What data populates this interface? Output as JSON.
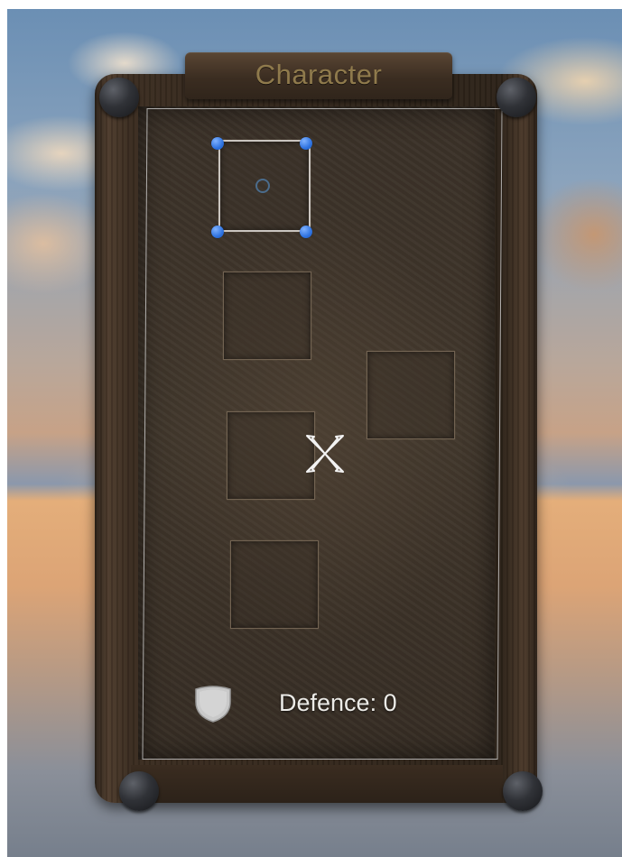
{
  "panel": {
    "title": "Character"
  },
  "equipment_slots": [
    {
      "id": "slot-1",
      "selected": true
    },
    {
      "id": "slot-2",
      "selected": false
    },
    {
      "id": "slot-3",
      "selected": false
    },
    {
      "id": "slot-4",
      "selected": false
    },
    {
      "id": "slot-5",
      "selected": false
    }
  ],
  "stats": {
    "defence_label": "Defence: 0",
    "defence_icon": "shield-icon"
  },
  "gizmo": {
    "handles_color": "#2f73e0",
    "move_tool_icon": "move-arrows-icon"
  }
}
